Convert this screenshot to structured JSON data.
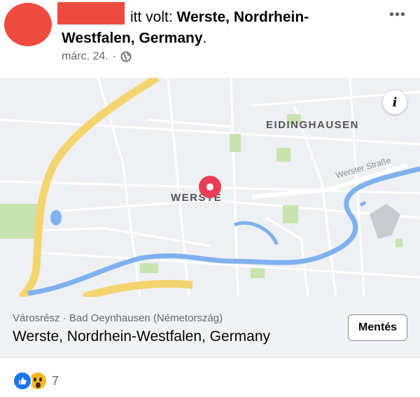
{
  "header": {
    "title_prefix": "itt volt: ",
    "title_location_line1": "Werste, Nordrhein-",
    "title_location_line2": "Westfalen, Germany",
    "title_suffix": ".",
    "date": "márc. 24.",
    "separator": "·",
    "privacy_icon": "globe-icon",
    "more_icon": "more-options-icon",
    "more_glyph": "•••"
  },
  "map": {
    "labels": {
      "district": "EIDINGHAUSEN",
      "place": "WERSTE",
      "street": "Werster Straße"
    },
    "info_icon": "i",
    "colors": {
      "background": "#eef0f3",
      "river": "#7fb1ee",
      "motorway": "#f4d46e",
      "park": "#c9e3b0",
      "pin": "#e83e57"
    }
  },
  "place": {
    "subtitle": "Városrész · Bad Oeynhausen (Németország)",
    "title": "Werste, Nordrhein-Westfalen, Germany",
    "save_label": "Mentés"
  },
  "reactions": {
    "icons": [
      "like-icon",
      "wow-icon"
    ],
    "count": "7"
  }
}
